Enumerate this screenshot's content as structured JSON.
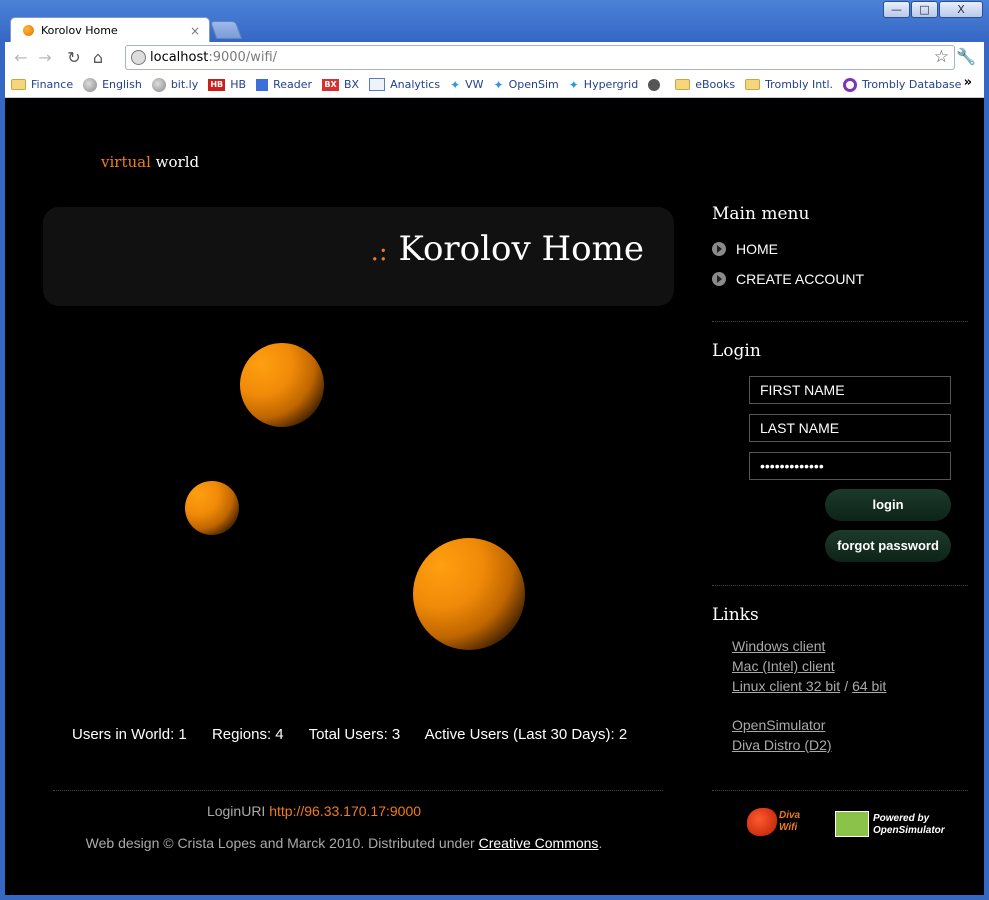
{
  "browser": {
    "tab_title": "Korolov Home",
    "tab_close": "×",
    "url_host": "localhost",
    "url_rest": ":9000/wifi/",
    "win_min": "—",
    "win_max": "□",
    "win_close": "X",
    "bookmarks": [
      {
        "label": "Finance",
        "icon": "folder-icon"
      },
      {
        "label": "English",
        "icon": "globe-icon"
      },
      {
        "label": "bit.ly",
        "icon": "globe-icon"
      },
      {
        "label": "HB",
        "icon": "hb-icon"
      },
      {
        "label": "Reader",
        "icon": "reader-icon"
      },
      {
        "label": "BX",
        "icon": "bx-icon"
      },
      {
        "label": "Analytics",
        "icon": "analytics-icon"
      },
      {
        "label": "VW",
        "icon": "twitter-icon"
      },
      {
        "label": "OpenSim",
        "icon": "twitter-icon"
      },
      {
        "label": "Hypergrid",
        "icon": "twitter-icon"
      },
      {
        "label": "",
        "icon": "clock-icon"
      },
      {
        "label": "eBooks",
        "icon": "folder-icon"
      },
      {
        "label": "Trombly Intl.",
        "icon": "folder-icon"
      },
      {
        "label": "Trombly Database",
        "icon": "trombly-icon"
      }
    ]
  },
  "site": {
    "logo_virtual": "virtual",
    "logo_world": "world",
    "banner_dots": ".:",
    "banner_title": "Korolov Home"
  },
  "stats": {
    "users_in_world": "Users in World: 1",
    "regions": "Regions: 4",
    "total_users": "Total Users: 3",
    "active_users": "Active Users (Last 30 Days): 2"
  },
  "footer": {
    "login_uri_label": "LoginURI",
    "login_uri": "http://96.33.170.17:9000",
    "copyright": "Web design © Crista Lopes and Marck 2010. Distributed under",
    "cc_link": "Creative Commons",
    "period": "."
  },
  "sidebar": {
    "main_menu_heading": "Main menu",
    "menu": [
      "HOME",
      "CREATE ACCOUNT"
    ],
    "login_heading": "Login",
    "first_name_placeholder": "FIRST NAME",
    "last_name_placeholder": "LAST NAME",
    "password_value": "•••••••••••••",
    "login_button": "login",
    "forgot_button": "forgot password",
    "links_heading": "Links",
    "links": {
      "windows": "Windows client",
      "mac": "Mac (Intel) client",
      "linux32": "Linux client 32 bit",
      "slash": "/",
      "linux64": "64 bit",
      "opensim": "OpenSimulator",
      "diva": "Diva Distro (D2)"
    },
    "diva_logo_l1": "Diva",
    "diva_logo_l2": "Wifi",
    "powered_l1": "Powered by",
    "powered_l2": "OpenSimulator"
  },
  "colors": {
    "accent": "#f07c1f",
    "page_bg": "#000000",
    "banner_bg": "#111111"
  }
}
